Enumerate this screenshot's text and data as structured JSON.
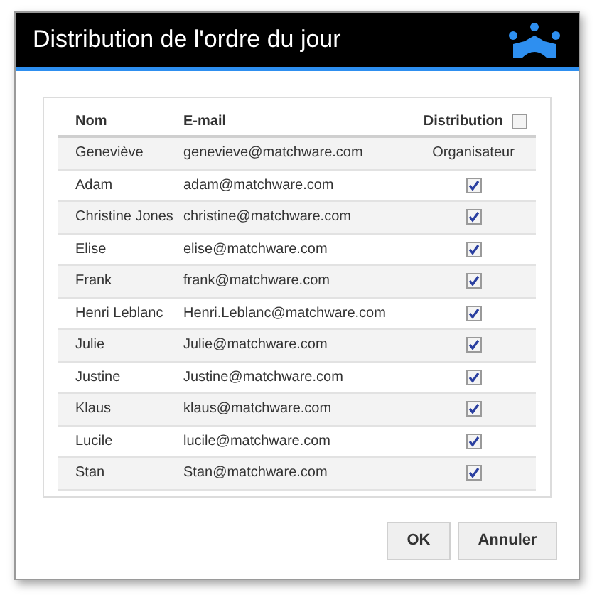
{
  "window": {
    "title": "Distribution de l'ordre du jour"
  },
  "table": {
    "columns": [
      "Nom",
      "E-mail",
      "Distribution"
    ],
    "all_checked": false,
    "rows": [
      {
        "name": "Geneviève",
        "email": "genevieve@matchware.com",
        "kind": "role",
        "role": "Organisateur"
      },
      {
        "name": "Adam",
        "email": "adam@matchware.com",
        "kind": "checkbox",
        "checked": true
      },
      {
        "name": "Christine Jones",
        "email": "christine@matchware.com",
        "kind": "checkbox",
        "checked": true
      },
      {
        "name": "Elise",
        "email": "elise@matchware.com",
        "kind": "checkbox",
        "checked": true
      },
      {
        "name": "Frank",
        "email": "frank@matchware.com",
        "kind": "checkbox",
        "checked": true
      },
      {
        "name": "Henri Leblanc",
        "email": "Henri.Leblanc@matchware.com",
        "kind": "checkbox",
        "checked": true
      },
      {
        "name": "Julie",
        "email": "Julie@matchware.com",
        "kind": "checkbox",
        "checked": true
      },
      {
        "name": "Justine",
        "email": "Justine@matchware.com",
        "kind": "checkbox",
        "checked": true
      },
      {
        "name": "Klaus",
        "email": "klaus@matchware.com",
        "kind": "checkbox",
        "checked": true
      },
      {
        "name": "Lucile",
        "email": "lucile@matchware.com",
        "kind": "checkbox",
        "checked": true
      },
      {
        "name": "Stan",
        "email": "Stan@matchware.com",
        "kind": "checkbox",
        "checked": true
      }
    ]
  },
  "buttons": [
    "OK",
    "Annuler"
  ]
}
